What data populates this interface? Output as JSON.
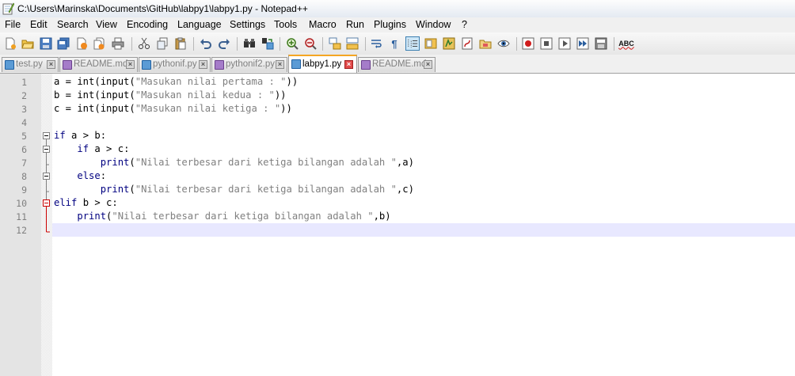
{
  "window": {
    "title": "C:\\Users\\Marinska\\Documents\\GitHub\\labpy1\\labpy1.py - Notepad++"
  },
  "menu": [
    "File",
    "Edit",
    "Search",
    "View",
    "Encoding",
    "Language",
    "Settings",
    "Tools",
    "Macro",
    "Run",
    "Plugins",
    "Window",
    "?"
  ],
  "tabs": [
    {
      "label": "test.py",
      "icon": "disk-blue-icon",
      "active": false
    },
    {
      "label": "README.md",
      "icon": "disk-purple-icon",
      "active": false
    },
    {
      "label": "pythonif.py",
      "icon": "disk-blue-icon",
      "active": false
    },
    {
      "label": "pythonif2.py",
      "icon": "disk-purple-icon",
      "active": false
    },
    {
      "label": "labpy1.py",
      "icon": "disk-blue-icon",
      "active": true
    },
    {
      "label": "README.md",
      "icon": "disk-purple-icon",
      "active": false
    }
  ],
  "editor": {
    "line_numbers": [
      "1",
      "2",
      "3",
      "4",
      "5",
      "6",
      "7",
      "8",
      "9",
      "10",
      "11",
      "12"
    ],
    "current_line": 12,
    "lines": [
      [
        {
          "t": "a = int(input(",
          "c": "d"
        },
        {
          "t": "\"Masukan nilai pertama : \"",
          "c": "s"
        },
        {
          "t": "))",
          "c": "d"
        }
      ],
      [
        {
          "t": "b = int(input(",
          "c": "d"
        },
        {
          "t": "\"Masukan nilai kedua : \"",
          "c": "s"
        },
        {
          "t": "))",
          "c": "d"
        }
      ],
      [
        {
          "t": "c = int(input(",
          "c": "d"
        },
        {
          "t": "\"Masukan nilai ketiga : \"",
          "c": "s"
        },
        {
          "t": "))",
          "c": "d"
        }
      ],
      [],
      [
        {
          "t": "if",
          "c": "k"
        },
        {
          "t": " a > b:",
          "c": "d"
        }
      ],
      [
        {
          "t": "    ",
          "c": "d"
        },
        {
          "t": "if",
          "c": "k"
        },
        {
          "t": " a > c:",
          "c": "d"
        }
      ],
      [
        {
          "t": "        ",
          "c": "d"
        },
        {
          "t": "print",
          "c": "k"
        },
        {
          "t": "(",
          "c": "d"
        },
        {
          "t": "\"Nilai terbesar dari ketiga bilangan adalah \"",
          "c": "s"
        },
        {
          "t": ",a)",
          "c": "d"
        }
      ],
      [
        {
          "t": "    ",
          "c": "d"
        },
        {
          "t": "else",
          "c": "k"
        },
        {
          "t": ":",
          "c": "d"
        }
      ],
      [
        {
          "t": "        ",
          "c": "d"
        },
        {
          "t": "print",
          "c": "k"
        },
        {
          "t": "(",
          "c": "d"
        },
        {
          "t": "\"Nilai terbesar dari ketiga bilangan adalah \"",
          "c": "s"
        },
        {
          "t": ",c)",
          "c": "d"
        }
      ],
      [
        {
          "t": "elif",
          "c": "k"
        },
        {
          "t": " b > c:",
          "c": "d"
        }
      ],
      [
        {
          "t": "    ",
          "c": "d"
        },
        {
          "t": "print",
          "c": "k"
        },
        {
          "t": "(",
          "c": "d"
        },
        {
          "t": "\"Nilai terbesar dari ketiga bilangan adalah \"",
          "c": "s"
        },
        {
          "t": ",b)",
          "c": "d"
        }
      ],
      []
    ]
  },
  "toolbar": {
    "icons": [
      "new-file-icon",
      "open-file-icon",
      "save-icon",
      "save-all-icon",
      "close-icon",
      "close-all-icon",
      "print-icon",
      "cut-icon",
      "copy-icon",
      "paste-icon",
      "undo-icon",
      "redo-icon",
      "find-icon",
      "replace-icon",
      "zoom-in-icon",
      "zoom-out-icon",
      "sync-vertical-icon",
      "sync-horizontal-icon",
      "word-wrap-icon",
      "show-all-chars-icon",
      "indent-guide-icon",
      "doc-map-icon",
      "function-list-icon",
      "folder-workspace-icon",
      "monitoring-icon",
      "record-macro-icon",
      "stop-record-icon",
      "play-macro-icon",
      "run-macro-multiple-icon",
      "save-macro-icon",
      "spellcheck-icon"
    ],
    "spellcheck_label": "ABC"
  },
  "colors": {
    "keyword": "#000080",
    "string": "#808080",
    "current_line": "#e8e8ff",
    "fold_marker_active": "#cc0000",
    "active_tab_accent": "#f5a623"
  }
}
